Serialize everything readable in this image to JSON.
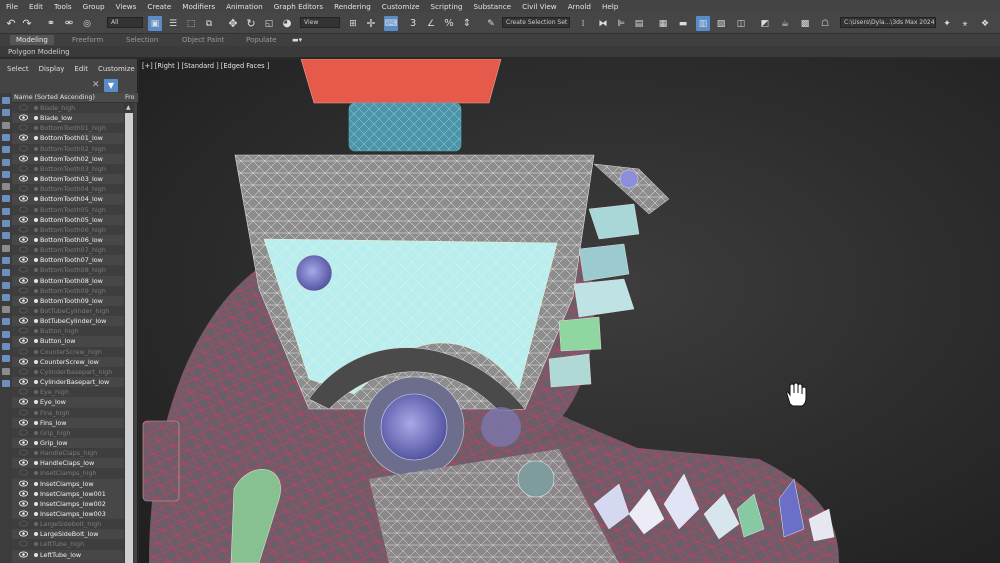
{
  "menu": [
    "File",
    "Edit",
    "Tools",
    "Group",
    "Views",
    "Create",
    "Modifiers",
    "Animation",
    "Graph Editors",
    "Rendering",
    "Customize",
    "Scripting",
    "Substance",
    "Civil View",
    "Arnold",
    "Help"
  ],
  "toolbar": {
    "filter_value": "All",
    "view_value": "View",
    "selection_set_placeholder": "Create Selection Set",
    "workspace_path": "C:\\Users\\Dyla...\\3ds Max 2024"
  },
  "ribbon": {
    "tabs": [
      "Modeling",
      "Freeform",
      "Selection",
      "Object Paint",
      "Populate"
    ],
    "active_tab": "Modeling",
    "panel_label": "Polygon Modeling"
  },
  "scene_explorer": {
    "menu": [
      "Select",
      "Display",
      "Edit",
      "Customize"
    ],
    "column_name": "Name (Sorted Ascending)",
    "column_frozen": "Fro",
    "items": [
      {
        "name": "Blade_high",
        "visible": false
      },
      {
        "name": "Blade_low",
        "visible": true
      },
      {
        "name": "BottomTooth01_high",
        "visible": false
      },
      {
        "name": "BottomTooth01_low",
        "visible": true
      },
      {
        "name": "BottomTooth02_high",
        "visible": false
      },
      {
        "name": "BottomTooth02_low",
        "visible": true
      },
      {
        "name": "BottomTooth03_high",
        "visible": false
      },
      {
        "name": "BottomTooth03_low",
        "visible": true
      },
      {
        "name": "BottomTooth04_high",
        "visible": false
      },
      {
        "name": "BottomTooth04_low",
        "visible": true
      },
      {
        "name": "BottomTooth05_high",
        "visible": false
      },
      {
        "name": "BottomTooth05_low",
        "visible": true
      },
      {
        "name": "BottomTooth06_high",
        "visible": false
      },
      {
        "name": "BottomTooth06_low",
        "visible": true
      },
      {
        "name": "BottomTooth07_high",
        "visible": false
      },
      {
        "name": "BottomTooth07_low",
        "visible": true
      },
      {
        "name": "BottomTooth08_high",
        "visible": false
      },
      {
        "name": "BottomTooth08_low",
        "visible": true
      },
      {
        "name": "BottomTooth09_high",
        "visible": false
      },
      {
        "name": "BottomTooth09_low",
        "visible": true
      },
      {
        "name": "BotTubeCylinder_high",
        "visible": false
      },
      {
        "name": "BotTubeCylinder_low",
        "visible": true
      },
      {
        "name": "Button_high",
        "visible": false
      },
      {
        "name": "Button_low",
        "visible": true
      },
      {
        "name": "CounterScrew_high",
        "visible": false
      },
      {
        "name": "CounterScrew_low",
        "visible": true
      },
      {
        "name": "CylinderBasepart_high",
        "visible": false
      },
      {
        "name": "CylinderBasepart_low",
        "visible": true
      },
      {
        "name": "Eye_high",
        "visible": false
      },
      {
        "name": "Eye_low",
        "visible": true
      },
      {
        "name": "Fins_high",
        "visible": false
      },
      {
        "name": "Fins_low",
        "visible": true
      },
      {
        "name": "Grip_high",
        "visible": false
      },
      {
        "name": "Grip_low",
        "visible": true
      },
      {
        "name": "HandleClaps_high",
        "visible": false
      },
      {
        "name": "HandleClaps_low",
        "visible": true
      },
      {
        "name": "InsetClamps_high",
        "visible": false
      },
      {
        "name": "InsetClamps_low",
        "visible": true
      },
      {
        "name": "InsetClamps_low001",
        "visible": true
      },
      {
        "name": "InsetClamps_low002",
        "visible": true
      },
      {
        "name": "InsetClamps_low003",
        "visible": true
      },
      {
        "name": "LargeSidebolt_high",
        "visible": false
      },
      {
        "name": "LargeSideBolt_low",
        "visible": true
      },
      {
        "name": "LeftTube_high",
        "visible": false
      },
      {
        "name": "LeftTube_low",
        "visible": true
      }
    ]
  },
  "viewport": {
    "label": "[+] [Right ] [Standard ] [Edged Faces ]"
  },
  "colors": {
    "accent": "#5a8cc8",
    "wire_red": "#d63a5a",
    "wire_white": "#e8e8e8",
    "glass": "#bfeff0"
  }
}
